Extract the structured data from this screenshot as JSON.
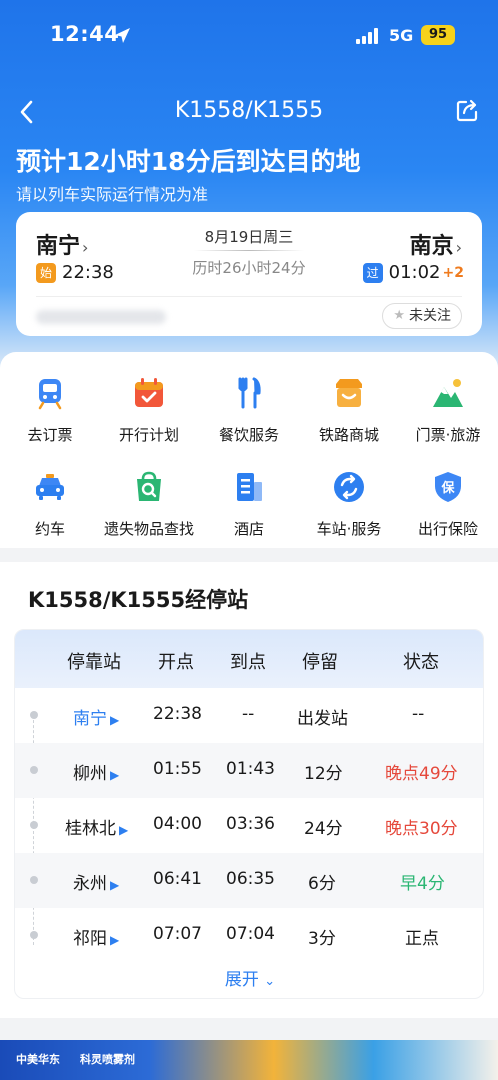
{
  "status_bar": {
    "time": "12:44",
    "network": "5G",
    "battery": "95"
  },
  "nav": {
    "title": "K1558/K1555"
  },
  "eta": {
    "headline": "预计12小时18分后到达目的地",
    "note": "请以列车实际运行情况为准"
  },
  "trip": {
    "from_station": "南宁",
    "to_station": "南京",
    "date": "8月19日周三",
    "duration": "历时26小时24分",
    "from_tag": "始",
    "from_time": "22:38",
    "to_tag": "过",
    "to_time": "01:02",
    "day_offset": "+2",
    "follow_label": "未关注"
  },
  "services": [
    {
      "label": "去订票",
      "icon": "train-ticket-icon"
    },
    {
      "label": "开行计划",
      "icon": "calendar-icon"
    },
    {
      "label": "餐饮服务",
      "icon": "dining-icon"
    },
    {
      "label": "铁路商城",
      "icon": "shop-icon"
    },
    {
      "label": "门票·旅游",
      "icon": "mountain-icon"
    },
    {
      "label": "约车",
      "icon": "taxi-icon"
    },
    {
      "label": "遗失物品查找",
      "icon": "lost-bag-icon"
    },
    {
      "label": "酒店",
      "icon": "hotel-icon"
    },
    {
      "label": "车站·服务",
      "icon": "station-service-icon"
    },
    {
      "label": "出行保险",
      "icon": "insurance-shield-icon"
    }
  ],
  "stops": {
    "title": "K1558/K1555经停站",
    "headers": [
      "停靠站",
      "开点",
      "到点",
      "停留",
      "状态"
    ],
    "rows": [
      {
        "station": "南宁",
        "depart": "22:38",
        "arrive": "--",
        "stay": "出发站",
        "status": "--",
        "status_type": "none"
      },
      {
        "station": "柳州",
        "depart": "01:55",
        "arrive": "01:43",
        "stay": "12分",
        "status": "晚点49分",
        "status_type": "late"
      },
      {
        "station": "桂林北",
        "depart": "04:00",
        "arrive": "03:36",
        "stay": "24分",
        "status": "晚点30分",
        "status_type": "late"
      },
      {
        "station": "永州",
        "depart": "06:41",
        "arrive": "06:35",
        "stay": "6分",
        "status": "早4分",
        "status_type": "early"
      },
      {
        "station": "祁阳",
        "depart": "07:07",
        "arrive": "07:04",
        "stay": "3分",
        "status": "正点",
        "status_type": "ontime"
      }
    ],
    "expand_label": "展开"
  },
  "ad": {
    "brand1": "中美华东",
    "brand2": "科灵喷雾剂"
  },
  "colors": {
    "primary": "#2d7ff0",
    "late": "#e5483b",
    "early": "#2bb673",
    "orange": "#f39a1e"
  }
}
